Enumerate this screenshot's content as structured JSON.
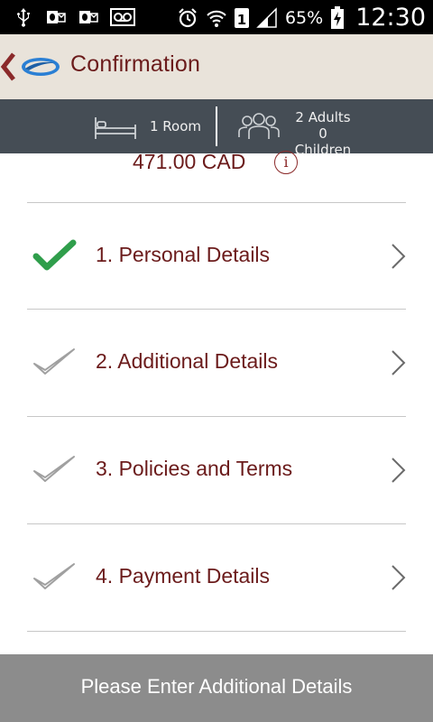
{
  "status_bar": {
    "battery_percent": "65%",
    "time": "12:30",
    "sim_slot": "1",
    "icons": [
      "usb-icon",
      "outlook-icon",
      "outlook-icon",
      "voicemail-icon",
      "alarm-icon",
      "wifi-icon",
      "sim-icon",
      "signal-icon",
      "battery-charging-icon"
    ]
  },
  "header": {
    "title": "Confirmation",
    "back_icon": "chevron-left-icon",
    "logo_icon": "app-logo-icon"
  },
  "booking_summary": {
    "rooms": "1 Room",
    "adults": "2 Adults",
    "children": "0 Children"
  },
  "price": {
    "amount": "471.00 CAD",
    "info_symbol": "i"
  },
  "steps": [
    {
      "label": "1. Personal Details",
      "completed": true
    },
    {
      "label": "2. Additional Details",
      "completed": false
    },
    {
      "label": "3. Policies and Terms",
      "completed": false
    },
    {
      "label": "4. Payment Details",
      "completed": false
    }
  ],
  "bottom_button": {
    "label": "Please Enter Additional Details"
  },
  "colors": {
    "accent_text": "#6b1b1b",
    "header_bg": "#e9e3da",
    "infobar_bg": "#454d55",
    "check_done": "#2f9e4b",
    "check_pending": "#9a9a9a",
    "button_bg": "#8c8c8c"
  }
}
